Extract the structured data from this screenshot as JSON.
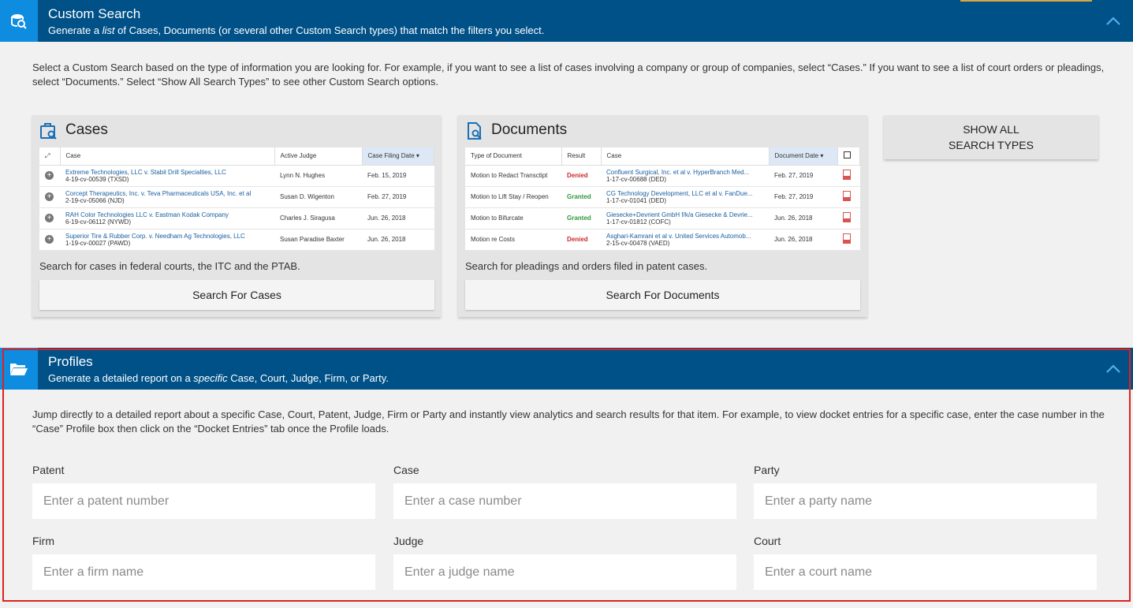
{
  "custom_search": {
    "title": "Custom Search",
    "subtitle_pre": "Generate a ",
    "subtitle_em": "list",
    "subtitle_post": " of Cases, Documents (or several other Custom Search types) that match the filters you select.",
    "intro": "Select a Custom Search based on the type of information you are looking for. For example, if you want to see a list of cases involving a company or group of companies, select “Cases.” If you want to see a list of court orders or pleadings, select “Documents.” Select “Show All Search Types” to see other Custom Search options.",
    "show_all_label": "SHOW ALL SEARCH TYPES"
  },
  "cases_card": {
    "title": "Cases",
    "columns": [
      "Case",
      "Active Judge",
      "Case Filing Date"
    ],
    "rows": [
      {
        "name": "Extreme Technologies, LLC v. Stabil Drill Specialties, LLC",
        "number": "4-19-cv-00539 (TXSD)",
        "judge": "Lynn N. Hughes",
        "date": "Feb. 15, 2019"
      },
      {
        "name": "Corcept Therapeutics, Inc. v. Teva Pharmaceuticals USA, Inc. et al",
        "number": "2-19-cv-05066 (NJD)",
        "judge": "Susan D. Wigenton",
        "date": "Feb. 27, 2019"
      },
      {
        "name": "RAH Color Technologies LLC v. Eastman Kodak Company",
        "number": "6-19-cv-06112 (NYWD)",
        "judge": "Charles J. Siragusa",
        "date": "Jun. 26, 2018"
      },
      {
        "name": "Superior Tire & Rubber Corp. v. Needham Ag Technologies, LLC",
        "number": "1-19-cv-00027 (PAWD)",
        "judge": "Susan Paradise Baxter",
        "date": "Jun. 26, 2018"
      }
    ],
    "description": "Search for cases in federal courts, the ITC and the PTAB.",
    "button_label": "Search For Cases"
  },
  "documents_card": {
    "title": "Documents",
    "columns": [
      "Type of Document",
      "Result",
      "Case",
      "Document Date"
    ],
    "rows": [
      {
        "type": "Motion to Redact Transctipt",
        "result": "Denied",
        "case": "Confluent Surgical, Inc. et al v. HyperBranch Med...",
        "number": "1-17-cv-00688 (DED)",
        "date": "Feb. 27, 2019"
      },
      {
        "type": "Motion to Lift Stay / Reopen",
        "result": "Granted",
        "case": "CG Technology Development, LLC et al v. FanDue...",
        "number": "1-17-cv-01041 (DED)",
        "date": "Feb. 27, 2019"
      },
      {
        "type": "Motion to Bifurcate",
        "result": "Granted",
        "case": "Giesecke+Devrient GmbH f/k/a Giesecke & Devrie...",
        "number": "1-17-cv-01812 (COFC)",
        "date": "Jun. 26, 2018"
      },
      {
        "type": "Motion re Costs",
        "result": "Denied",
        "case": "Asghari-Kamrani et al v. United Services Automob...",
        "number": "2-15-cv-00478 (VAED)",
        "date": "Jun. 26, 2018"
      }
    ],
    "description": "Search for pleadings and orders filed in patent cases.",
    "button_label": "Search For Documents"
  },
  "profiles": {
    "title": "Profiles",
    "subtitle_pre": "Generate a detailed report on a ",
    "subtitle_em": "specific",
    "subtitle_post": " Case, Court, Judge, Firm, or Party.",
    "intro": "Jump directly to a detailed report about a specific Case, Court, Patent, Judge, Firm or Party and instantly view analytics and search results for that item. For example, to view docket entries for a specific case, enter the case number in the “Case” Profile box then click on the “Docket Entries” tab once the Profile loads.",
    "fields": {
      "patent": {
        "label": "Patent",
        "placeholder": "Enter a patent number"
      },
      "case": {
        "label": "Case",
        "placeholder": "Enter a case number"
      },
      "party": {
        "label": "Party",
        "placeholder": "Enter a party name"
      },
      "firm": {
        "label": "Firm",
        "placeholder": "Enter a firm name"
      },
      "judge": {
        "label": "Judge",
        "placeholder": "Enter a judge name"
      },
      "court": {
        "label": "Court",
        "placeholder": "Enter a court name"
      }
    }
  },
  "colors": {
    "header_bg": "#005188",
    "icon_bg": "#0d8ce0",
    "highlight_border": "#e02020",
    "denied": "#cc2a2a",
    "granted": "#2d9a3c"
  }
}
